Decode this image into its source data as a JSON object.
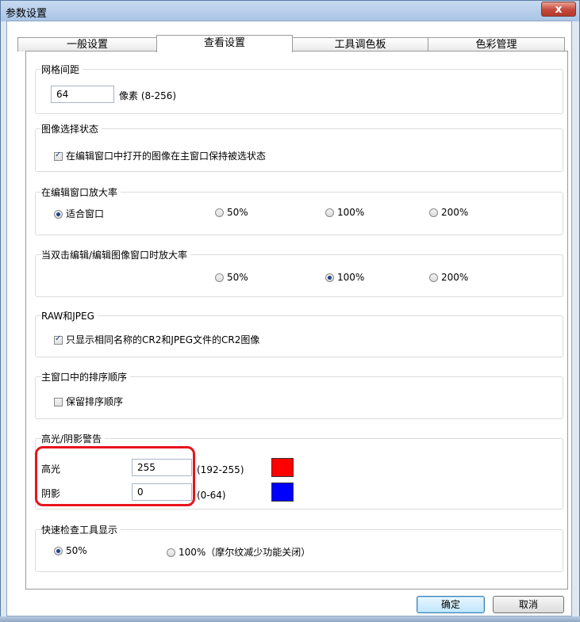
{
  "window": {
    "title": "参数设置",
    "close_glyph": "x"
  },
  "tabs": [
    {
      "label": "一般设置"
    },
    {
      "label": "查看设置"
    },
    {
      "label": "工具调色板"
    },
    {
      "label": "色彩管理"
    }
  ],
  "grid_spacing": {
    "title": "网格间距",
    "value": "64",
    "unit": "像素 (8-256)"
  },
  "image_selection": {
    "title": "图像选择状态",
    "option": "在编辑窗口中打开的图像在主窗口保持被选状态",
    "checked": true
  },
  "edit_zoom": {
    "title": "在编辑窗口放大率",
    "options": [
      "适合窗口",
      "50%",
      "100%",
      "200%"
    ],
    "selected": "适合窗口"
  },
  "double_click_zoom": {
    "title": "当双击编辑/编辑图像窗口时放大率",
    "options": [
      "50%",
      "100%",
      "200%"
    ],
    "selected": "100%"
  },
  "raw_jpeg": {
    "title": "RAW和JPEG",
    "option": "只显示相同名称的CR2和JPEG文件的CR2图像",
    "checked": true
  },
  "sort_order": {
    "title": "主窗口中的排序顺序",
    "option": "保留排序顺序",
    "checked": false
  },
  "warning": {
    "title": "高光/阴影警告",
    "highlight_label": "高光",
    "highlight_value": "255",
    "highlight_range": "(192-255)",
    "highlight_color": "#ff0000",
    "shadow_label": "阴影",
    "shadow_value": "0",
    "shadow_range": "(0-64)",
    "shadow_color": "#0000ff"
  },
  "quick_check": {
    "title": "快速检查工具显示",
    "options": [
      "50%",
      "100%（摩尔纹减少功能关闭）"
    ],
    "selected": "50%"
  },
  "buttons": {
    "ok": "确定",
    "cancel": "取消"
  }
}
